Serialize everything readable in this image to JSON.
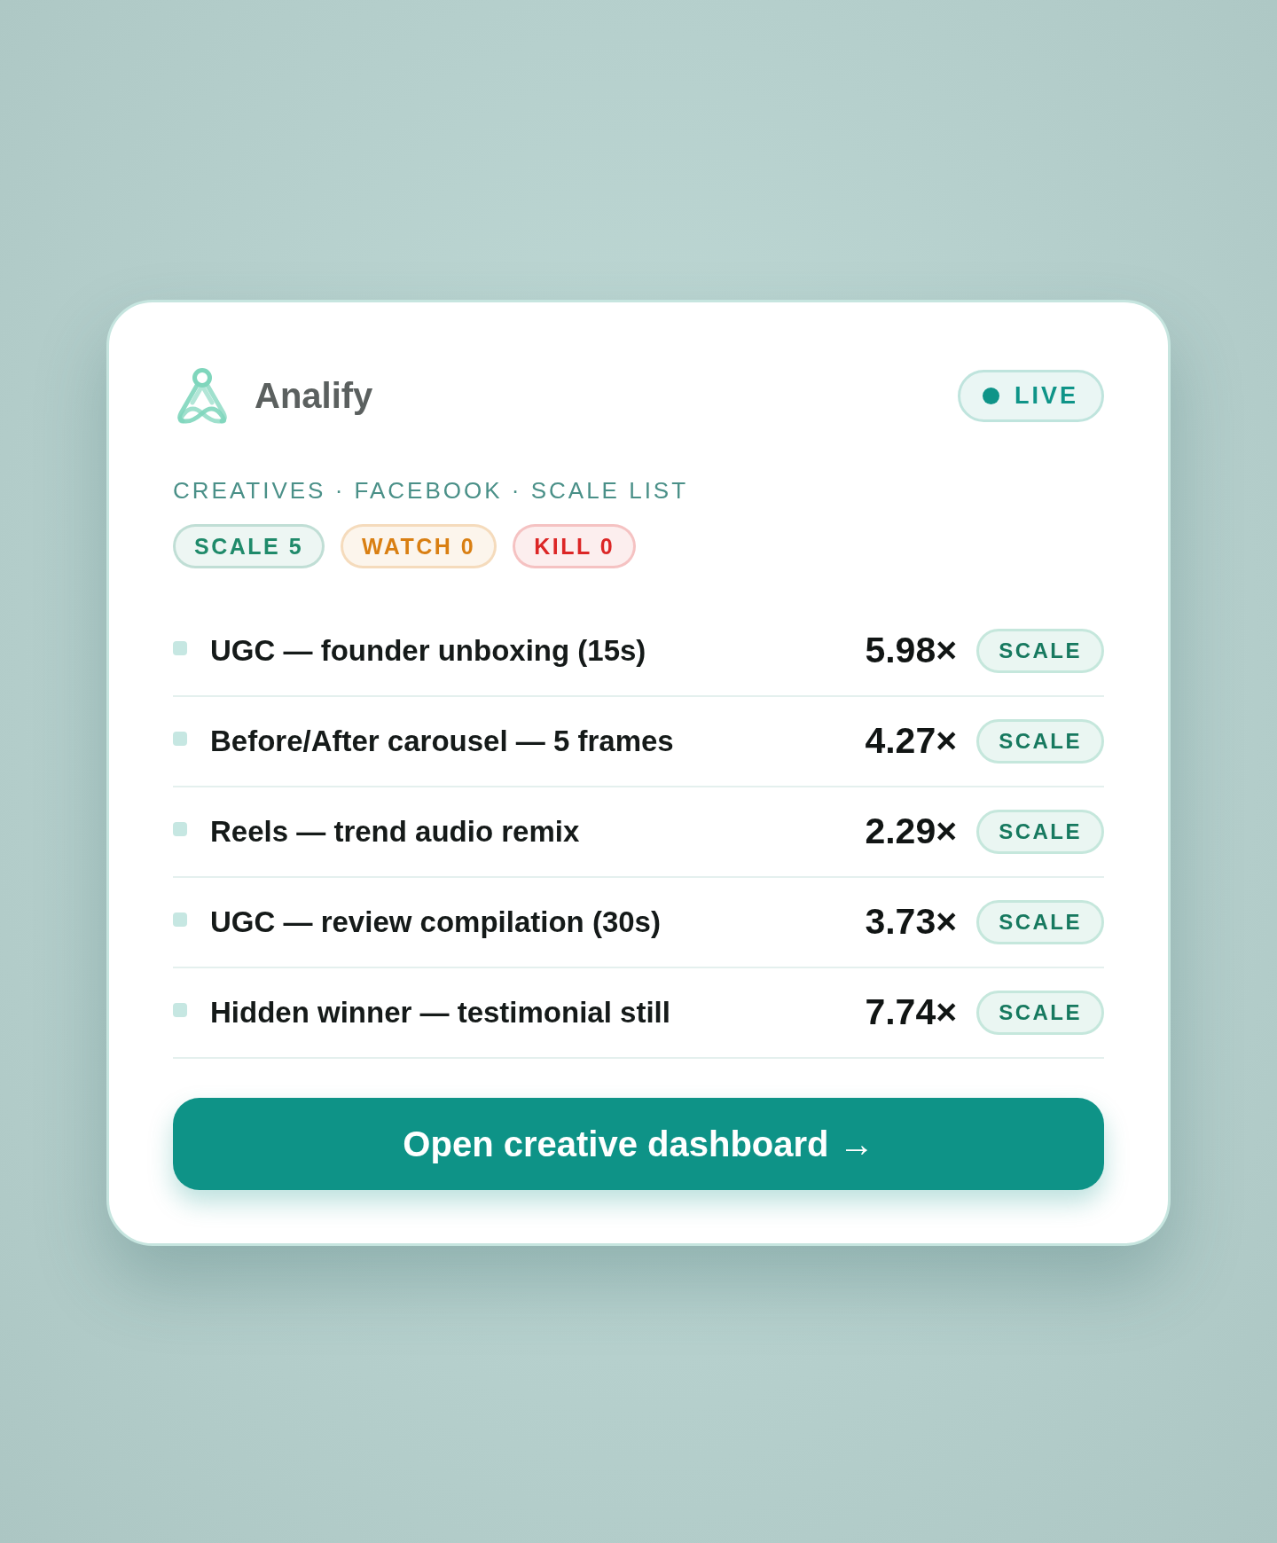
{
  "brand": {
    "name": "Analify"
  },
  "status_badge": {
    "label": "LIVE"
  },
  "breadcrumb": "CREATIVES · FACEBOOK · SCALE LIST",
  "summary": [
    {
      "label": "SCALE 5",
      "color": "#1f8a6a"
    },
    {
      "label": "WATCH 0",
      "color": "#d97f12"
    },
    {
      "label": "KILL 0",
      "color": "#dc2626"
    }
  ],
  "creatives": [
    {
      "title": "UGC — founder unboxing (15s)",
      "roas": "5.98×",
      "tag": "SCALE"
    },
    {
      "title": "Before/After carousel — 5 frames",
      "roas": "4.27×",
      "tag": "SCALE"
    },
    {
      "title": "Reels — trend audio remix",
      "roas": "2.29×",
      "tag": "SCALE"
    },
    {
      "title": "UGC — review compilation (30s)",
      "roas": "3.73×",
      "tag": "SCALE"
    },
    {
      "title": "Hidden winner — testimonial still",
      "roas": "7.74×",
      "tag": "SCALE"
    }
  ],
  "cta": {
    "label": "Open creative dashboard →"
  }
}
